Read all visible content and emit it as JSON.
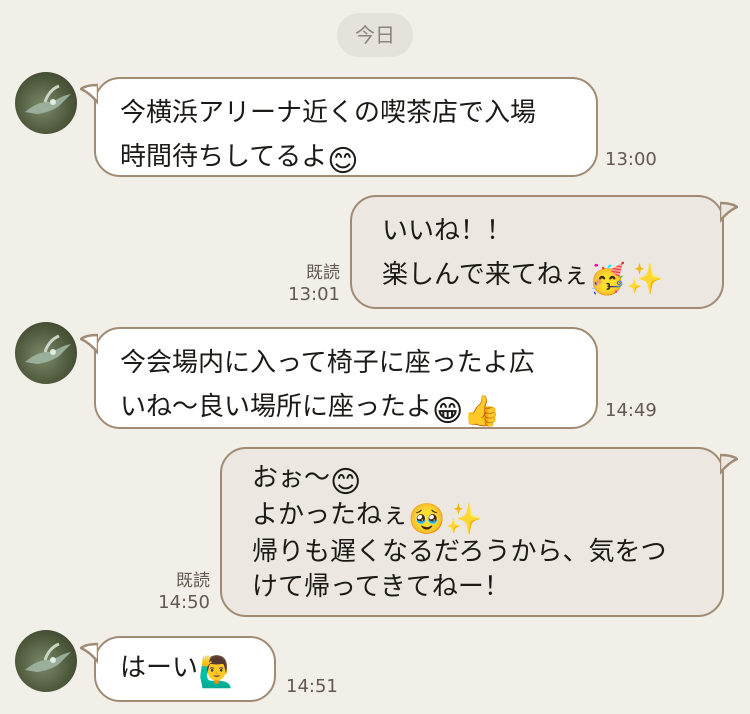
{
  "date_divider": "今日",
  "messages": [
    {
      "direction": "incoming",
      "lines": [
        "今横浜アリーナ近くの喫茶店で入場",
        "時間待ちしてるよ"
      ],
      "emoji": [
        "😊"
      ],
      "time": "13:00"
    },
    {
      "direction": "outgoing",
      "lines": [
        "いいね！！",
        "楽しんで来てねぇ"
      ],
      "emoji": [
        "🥳",
        "✨"
      ],
      "read": "既読",
      "time": "13:01"
    },
    {
      "direction": "incoming",
      "lines": [
        "今会場内に入って椅子に座ったよ広",
        "いね〜良い場所に座ったよ"
      ],
      "emoji": [
        "😁",
        "👍"
      ],
      "time": "14:49"
    },
    {
      "direction": "outgoing",
      "lines": [
        "おぉ〜",
        "よかったねぇ",
        "帰りも遅くなるだろうから、気をつ",
        "けて帰ってきてねー！"
      ],
      "emoji": [
        "😊",
        "🥹",
        "✨"
      ],
      "read": "既読",
      "time": "14:50"
    },
    {
      "direction": "incoming",
      "lines": [
        "はーい"
      ],
      "emoji": [
        "🙋‍♂️"
      ],
      "time": "14:51"
    }
  ],
  "colors": {
    "background": "#f2eee8",
    "bubble_border": "#a08b74",
    "incoming_bubble": "#ffffff",
    "outgoing_bubble": "#ece7e0"
  }
}
